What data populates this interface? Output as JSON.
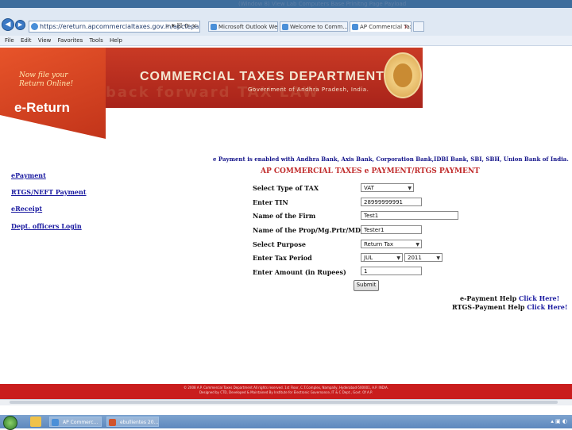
{
  "slide": {
    "caption": "(Window 8) View Lab Computers Base Prinitng Page Payload"
  },
  "browser": {
    "address": "https://ereturn.apcommercialtaxes.gov.in/apctepayr",
    "address_icons": "⌕ ▾ ☒ ⟳ ×",
    "tabs": [
      {
        "label": "Microsoft Outlook Web..."
      },
      {
        "label": "Welcome to Comm..."
      },
      {
        "label": "AP Commercial Taxes"
      }
    ],
    "tab_close": "×",
    "menu": [
      "File",
      "Edit",
      "View",
      "Favorites",
      "Tools",
      "Help"
    ]
  },
  "header": {
    "tagline_line1": "Now file your",
    "tagline_line2": "Return Online!",
    "ereturn_label": "e-Return",
    "title": "COMMERCIAL TAXES DEPARTMENT",
    "subtitle": "Government of Andhra Pradesh, India.",
    "banner_faded": "back   forward   TAX   LAW"
  },
  "notice": "e Payment is enabled with Andhra Bank, Axis Bank, Corporation Bank,IDBI Bank, SBI, SBH, Union Bank of India.",
  "form": {
    "title": "AP COMMERCIAL TAXES e PAYMENT/RTGS PAYMENT",
    "labels": {
      "tax_type": "Select Type of TAX",
      "tin": "Enter TIN",
      "firm": "Name of the Firm",
      "prop": "Name of the Prop/Mg.Prtr/MD",
      "purpose": "Select Purpose",
      "period": "Enter Tax Period",
      "amount": "Enter Amount (in Rupees)"
    },
    "values": {
      "tax_type": "VAT",
      "tin": "28999999991",
      "firm": "Test1",
      "prop": "Tester1",
      "purpose": "Return Tax",
      "month": "JUL",
      "year": "2011",
      "amount": "1"
    },
    "submit": "Submit"
  },
  "sidebar": {
    "links": [
      "ePayment",
      "RTGS/NEFT Payment",
      "eReceipt",
      "Dept. officers Login"
    ]
  },
  "help": {
    "epay_prefix": "e-Payment Help",
    "epay_link": "Click Here!",
    "rtgs_prefix": "RTGS-Payment Help",
    "rtgs_link": "Click Here!"
  },
  "footer": {
    "line1": "© 2008 A.P. Commercial Taxes Department All rights reserved. 1st Floor, C.T.Complex, Nampally, Hyderabad-500001, A.P. INDIA.",
    "line2": "Designed by CTD, Developed & Maintained By Institute for Electronic Governance, IT & C Dept., Govt. Of A.P."
  },
  "taskbar": {
    "tasks": [
      {
        "label": "AP Commerc..."
      },
      {
        "label": "ebullientes 20..."
      }
    ],
    "tray_text": "▴ ▣ ◐"
  },
  "colors": {
    "header_red": "#c93a25",
    "footer_red": "#c91d1d",
    "link_blue": "#1a1aa0",
    "title_red": "#c02a2a"
  }
}
